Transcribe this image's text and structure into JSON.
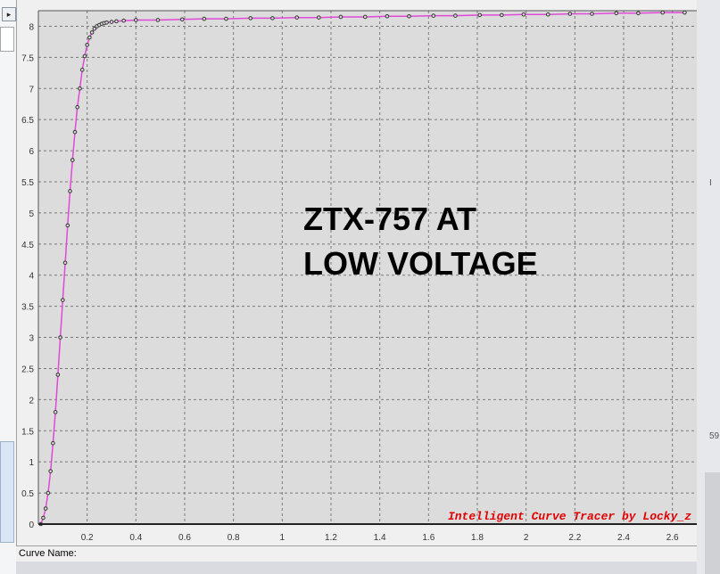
{
  "window": {
    "status_label": "Curve Name:",
    "left_arrow_glyph": "▸",
    "right_side_mark": "I",
    "right_side_number": "59"
  },
  "colors": {
    "plot_background": "#dcdcdc",
    "grid": "#7a7a7a",
    "curve_line": "#e048d8",
    "curve_markers": "#333333",
    "watermark": "#e00000",
    "annotation": "#000000"
  },
  "chart_data": {
    "type": "line",
    "title": "",
    "xlabel": "",
    "ylabel": "",
    "xlim": [
      0,
      2.7
    ],
    "ylim": [
      0,
      8.25
    ],
    "grid": true,
    "x_ticks": [
      "0.2",
      "0.4",
      "0.6",
      "0.8",
      "1",
      "1.2",
      "1.4",
      "1.6",
      "1.8",
      "2",
      "2.2",
      "2.4",
      "2.6"
    ],
    "y_ticks": [
      "0",
      "0.5",
      "1",
      "1.5",
      "2",
      "2.5",
      "3",
      "3.5",
      "4",
      "4.5",
      "5",
      "5.5",
      "6",
      "6.5",
      "7",
      "7.5",
      "8"
    ],
    "annotation_lines": [
      "ZTX-757 AT",
      "LOW VOLTAGE"
    ],
    "watermark": "Intelligent Curve Tracer by Locky_z",
    "series": [
      {
        "x": [
          0.01,
          0.02,
          0.03,
          0.04,
          0.05,
          0.06,
          0.07,
          0.08,
          0.09,
          0.1,
          0.11,
          0.12,
          0.13,
          0.14,
          0.15,
          0.16,
          0.17,
          0.18,
          0.19,
          0.2,
          0.21,
          0.22,
          0.23,
          0.24,
          0.25,
          0.26,
          0.27,
          0.28,
          0.3,
          0.32,
          0.35,
          0.4,
          0.49,
          0.59,
          0.68,
          0.77,
          0.87,
          0.96,
          1.06,
          1.15,
          1.24,
          1.34,
          1.43,
          1.52,
          1.62,
          1.71,
          1.81,
          1.9,
          1.99,
          2.09,
          2.18,
          2.27,
          2.37,
          2.46,
          2.56,
          2.65
        ],
        "y": [
          0.0,
          0.1,
          0.25,
          0.5,
          0.85,
          1.3,
          1.8,
          2.4,
          3.0,
          3.6,
          4.2,
          4.8,
          5.35,
          5.85,
          6.3,
          6.7,
          7.0,
          7.3,
          7.52,
          7.7,
          7.82,
          7.9,
          7.96,
          8.0,
          8.02,
          8.04,
          8.05,
          8.06,
          8.07,
          8.08,
          8.09,
          8.1,
          8.1,
          8.11,
          8.12,
          8.12,
          8.13,
          8.13,
          8.14,
          8.14,
          8.15,
          8.15,
          8.16,
          8.16,
          8.17,
          8.17,
          8.18,
          8.18,
          8.19,
          8.19,
          8.2,
          8.2,
          8.21,
          8.21,
          8.22,
          8.22
        ]
      }
    ]
  }
}
